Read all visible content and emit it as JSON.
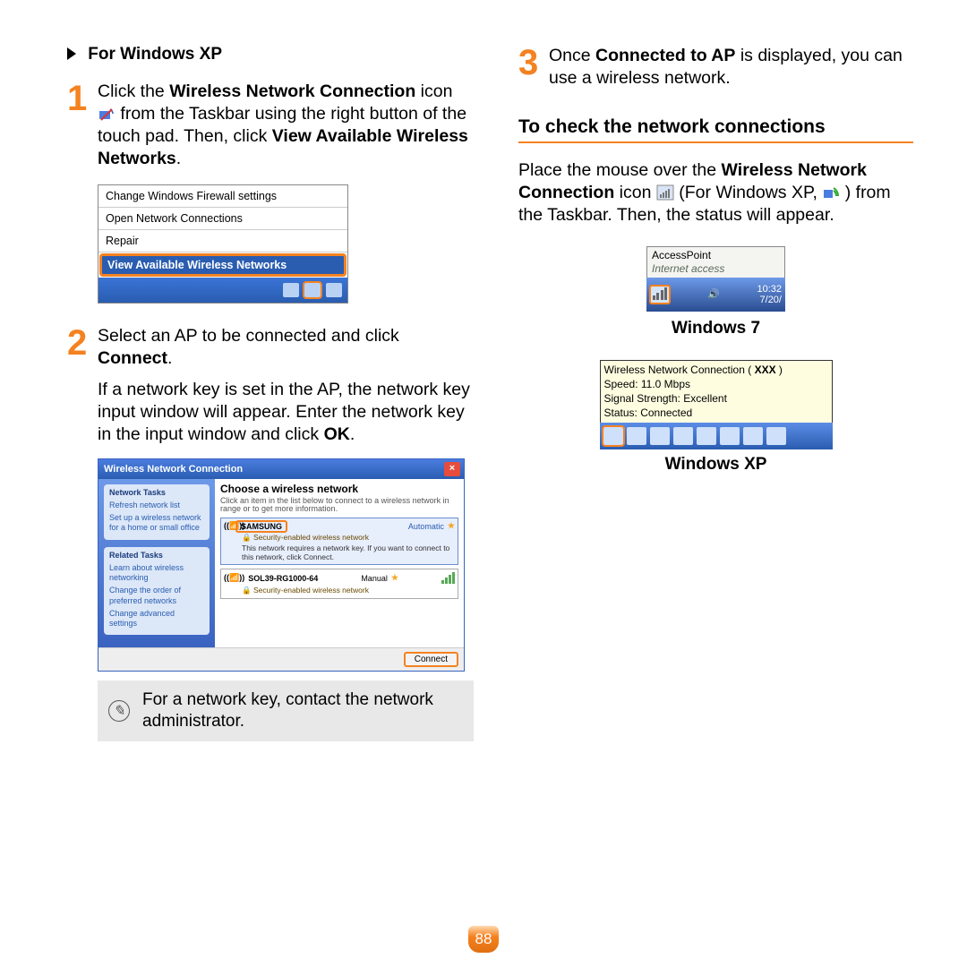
{
  "left": {
    "section_title": "For Windows XP",
    "step1": {
      "num": "1",
      "text_a": "Click the ",
      "bold_a": "Wireless Network Connection",
      "text_b": " icon ",
      "text_c": " from the Taskbar using the right button of the touch pad. Then, click ",
      "bold_b": "View Available Wireless Networks",
      "text_d": "."
    },
    "menu": {
      "i1": "Change Windows Firewall settings",
      "i2": "Open Network Connections",
      "i3": "Repair",
      "hl": "View Available Wireless Networks"
    },
    "step2": {
      "num": "2",
      "text_a": "Select an AP to be connected and click ",
      "bold_a": "Connect",
      "text_b": ".",
      "para2_a": "If a network key is set in the AP, the network key input window will appear. Enter the network key in the input window and click ",
      "para2_bold": "OK",
      "para2_b": "."
    },
    "wifi": {
      "title": "Wireless Network Connection",
      "side_h1": "Network Tasks",
      "side_l1": "Refresh network list",
      "side_l2": "Set up a wireless network for a home or small office",
      "side_h2": "Related Tasks",
      "side_l3": "Learn about wireless networking",
      "side_l4": "Change the order of preferred networks",
      "side_l5": "Change advanced settings",
      "main_h": "Choose a wireless network",
      "main_sub": "Click an item in the list below to connect to a wireless network in range or to get more information.",
      "n1_name": "SAMSUNG",
      "n1_mode": "Automatic",
      "n1_sec": "Security-enabled wireless network",
      "n1_desc": "This network requires a network key. If you want to connect to this network, click Connect.",
      "n2_name": "SOL39-RG1000-64",
      "n2_mode": "Manual",
      "n2_sec": "Security-enabled wireless network",
      "connect": "Connect"
    },
    "note": "For a network key, contact the network administrator."
  },
  "right": {
    "step3": {
      "num": "3",
      "text_a": "Once ",
      "bold_a": "Connected to AP",
      "text_b": " is displayed, you can use a wireless network."
    },
    "h2": "To check the network connections",
    "para_a": "Place the mouse over the ",
    "para_bold": "Wireless Network Connection",
    "para_b": " icon ",
    "para_c": " (For Windows XP, ",
    "para_d": ") from the Taskbar. Then, the status will appear.",
    "win7": {
      "l1": "AccessPoint",
      "l2": "Internet access",
      "time": "10:32",
      "date": "7/20/",
      "label": "Windows 7"
    },
    "winxp": {
      "l1a": "Wireless Network Connection ( ",
      "l1b": "XXX",
      "l1c": " )",
      "l2": "Speed: 11.0 Mbps",
      "l3": "Signal Strength: Excellent",
      "l4": "Status: Connected",
      "label": "Windows XP"
    }
  },
  "pagenum": "88"
}
